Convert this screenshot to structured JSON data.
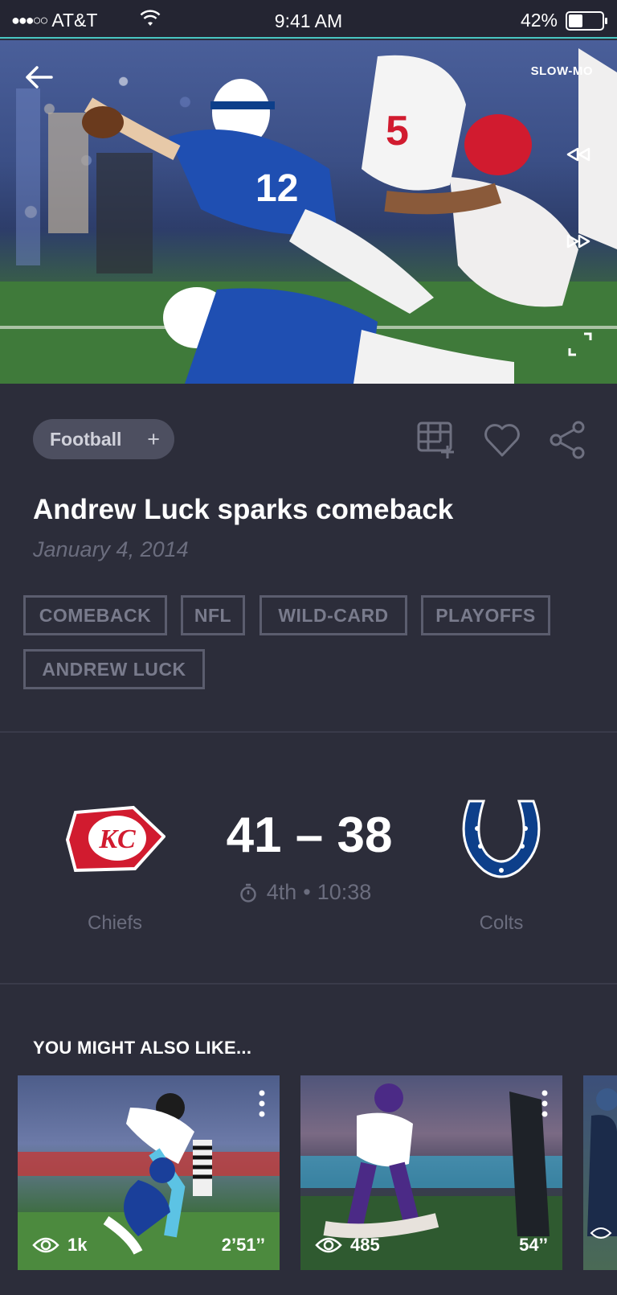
{
  "status_bar": {
    "signal_dots": "●●●○○",
    "carrier": "AT&T",
    "time": "9:41 AM",
    "battery_percent": "42%",
    "battery_level": 0.42
  },
  "hero": {
    "slowmo_label": "SLOW-MO",
    "jersey_number": "12"
  },
  "meta": {
    "sport_chip": "Football",
    "sport_chip_plus": "+",
    "title": "Andrew Luck sparks comeback",
    "date": "January 4, 2014",
    "tags": [
      "COMEBACK",
      "NFL",
      "WILD-CARD",
      "PLAYOFFS",
      "ANDREW LUCK"
    ]
  },
  "game": {
    "home_team": "Chiefs",
    "away_team": "Colts",
    "score": "41 – 38",
    "period": "4th",
    "separator": "•",
    "clock": "10:38",
    "home_logo_text": "KC"
  },
  "recommendations": {
    "section_title": "YOU MIGHT ALSO LIKE...",
    "items": [
      {
        "views": "1k",
        "duration": "2’51’’"
      },
      {
        "views": "485",
        "duration": "54’’"
      }
    ]
  },
  "colors": {
    "background": "#2c2d3a",
    "accent_teal": "#48c6c2",
    "muted_text": "#6b6d7e",
    "chip_bg": "#4d4f60",
    "colts_blue": "#0d3f8a",
    "chiefs_red": "#d11b2f"
  },
  "icons": [
    "back-arrow-icon",
    "rewind-icon",
    "fast-forward-icon",
    "expand-icon",
    "add-to-collection-icon",
    "heart-icon",
    "share-icon",
    "stopwatch-icon",
    "eye-icon",
    "more-vertical-icon",
    "wifi-icon",
    "battery-icon"
  ]
}
